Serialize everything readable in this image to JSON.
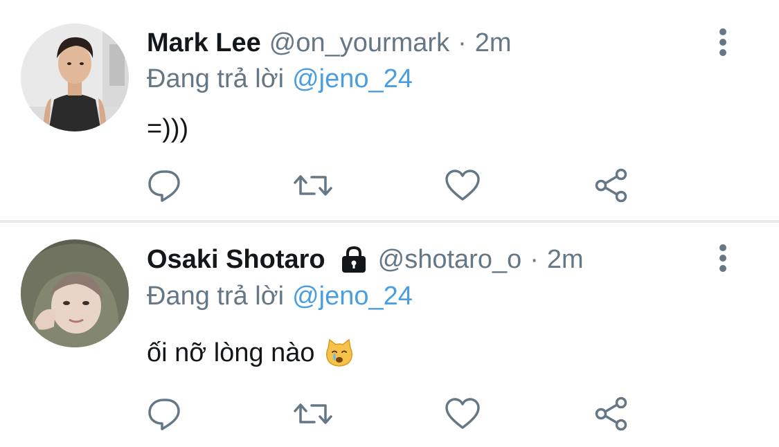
{
  "colors": {
    "name": "#14171a",
    "secondary": "#657786",
    "mention": "#4a9ee0",
    "divider": "#e6ecf0",
    "icon": "#657786"
  },
  "tweets": [
    {
      "name": "Mark Lee",
      "handle": "@on_yourmark",
      "separator": "·",
      "time": "2m",
      "replying_prefix": "Đang trả lời",
      "replying_to": "@jeno_24",
      "text": "=)))",
      "protected": false,
      "avatar_icon": "avatar-photo",
      "actions": [
        "reply-icon",
        "retweet-icon",
        "like-icon",
        "share-icon"
      ]
    },
    {
      "name": "Osaki Shotaro",
      "handle": "@shotaro_o",
      "separator": "·",
      "time": "2m",
      "replying_prefix": "Đang trả lời",
      "replying_to": "@jeno_24",
      "text": "ối nỡ lòng nào",
      "text_emoji": "crying-cat-face",
      "protected": true,
      "avatar_icon": "avatar-photo",
      "actions": [
        "reply-icon",
        "retweet-icon",
        "like-icon",
        "share-icon"
      ]
    }
  ]
}
